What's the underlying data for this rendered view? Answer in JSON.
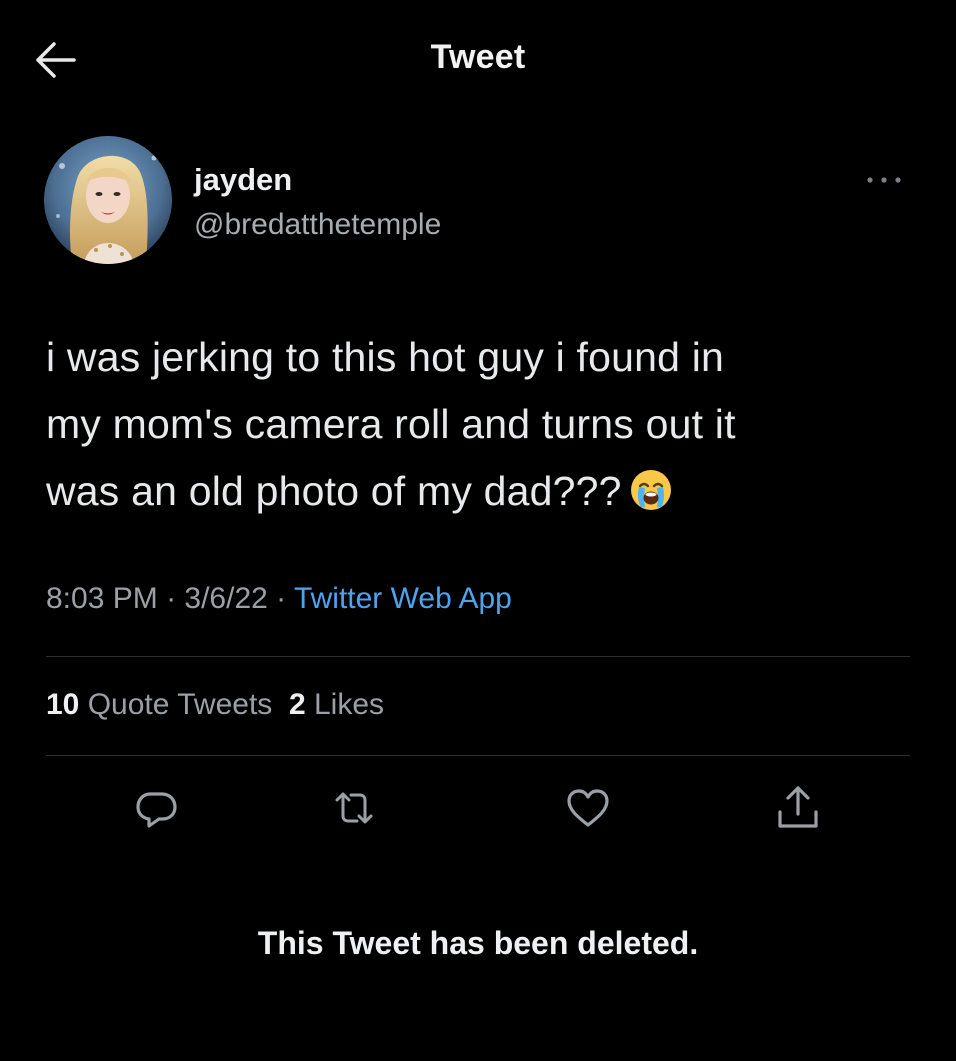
{
  "header": {
    "title": "Tweet",
    "back_icon": "arrow-left-icon"
  },
  "author": {
    "display_name": "jayden",
    "handle": "@bredatthetemple",
    "more_icon": "more-horizontal-icon"
  },
  "tweet": {
    "text_lines": [
      "i was jerking to this hot guy i found in",
      "my mom's camera roll and turns out it",
      "was an old photo of my dad???"
    ],
    "emoji": "loudly-crying-face-emoji"
  },
  "meta": {
    "time": "8:03 PM",
    "separator": " · ",
    "date": "3/6/22",
    "source": "Twitter Web App"
  },
  "stats": {
    "quote_count": "10",
    "quote_label": "Quote Tweets",
    "like_count": "2",
    "like_label": "Likes"
  },
  "actions": {
    "reply_icon": "reply-icon",
    "retweet_icon": "retweet-icon",
    "like_icon": "heart-icon",
    "share_icon": "share-icon"
  },
  "status": {
    "deleted_message": "This Tweet has been deleted."
  },
  "colors": {
    "background": "#000000",
    "text_primary": "#e7e9ea",
    "text_secondary": "#9aa0a6",
    "link": "#4da3ef",
    "divider": "#2b2d30"
  }
}
